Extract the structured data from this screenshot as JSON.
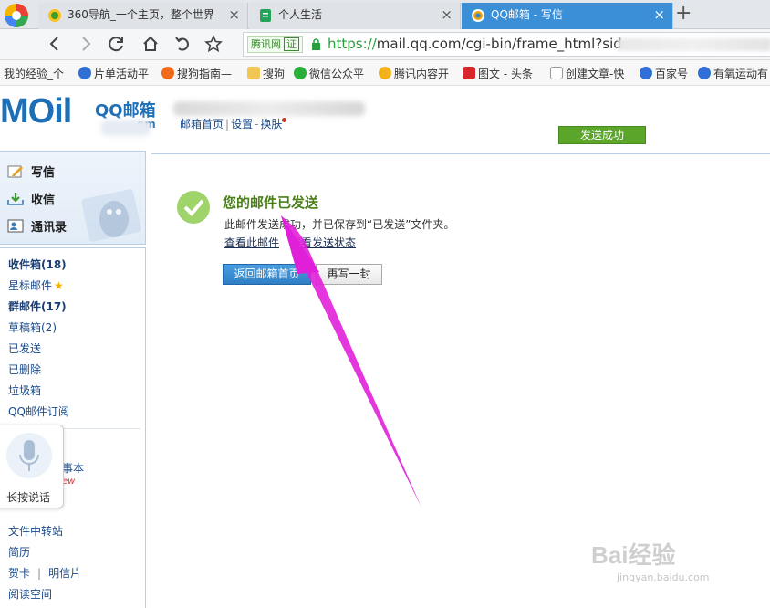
{
  "browser": {
    "tabs": [
      {
        "label": "360导航_一个主页，整个世界",
        "active": false
      },
      {
        "label": "个人生活",
        "active": false
      },
      {
        "label": "QQ邮箱 - 写信",
        "active": true
      }
    ],
    "close_glyph": "×",
    "new_tab_glyph": "+",
    "url": {
      "scheme": "https://",
      "rest": "mail.qq.com/cgi-bin/frame_html?sid"
    },
    "site_badge": "腾讯网",
    "cert_label": "证",
    "bookmarks": [
      "我的经验_个",
      "片单活动平",
      "搜狗指南—",
      "搜狗",
      "微信公众平",
      "腾讯内容开",
      "图文 - 头条",
      "创建文章-快",
      "百家号",
      "有氧运动有"
    ]
  },
  "header": {
    "logo": "MOil",
    "brand": "QQ邮箱",
    "brand_suffix": "om",
    "links": [
      "邮箱首页",
      "设置",
      "换肤"
    ],
    "sep_pipe": "|",
    "sep_dash": "-",
    "status_badge": "发送成功"
  },
  "sidebar": {
    "actions": [
      "写信",
      "收信",
      "通讯录"
    ],
    "folders": [
      {
        "label": "收件箱(18)",
        "bold": true
      },
      {
        "label": "星标邮件",
        "bold": false,
        "star": true
      },
      {
        "label": "群邮件(17)",
        "bold": true
      },
      {
        "label": "草稿箱(2)",
        "bold": false
      },
      {
        "label": "已发送",
        "bold": false
      },
      {
        "label": "已删除",
        "bold": false
      },
      {
        "label": "垃圾箱",
        "bold": false
      },
      {
        "label": "QQ邮件订阅",
        "bold": false
      }
    ],
    "partial_label": "事本",
    "partial_new": "ew",
    "more": [
      "文件中转站",
      "简历",
      "贺卡",
      "明信片",
      "阅读空间"
    ],
    "voice_label": "长按说话"
  },
  "main": {
    "title": "您的邮件已发送",
    "desc": "此邮件发送成功，并已保存到“已发送”文件夹。",
    "link_view": "查看此邮件",
    "link_status": "查看发送状态",
    "btn_home": "返回邮箱首页",
    "btn_again": "再写一封"
  },
  "watermark": {
    "main": "Bai经验",
    "sub": "jingyan.baidu.com"
  },
  "colors": {
    "accent": "#3b8fd6",
    "success": "#5aa52a",
    "annotation": "#e020d8"
  }
}
